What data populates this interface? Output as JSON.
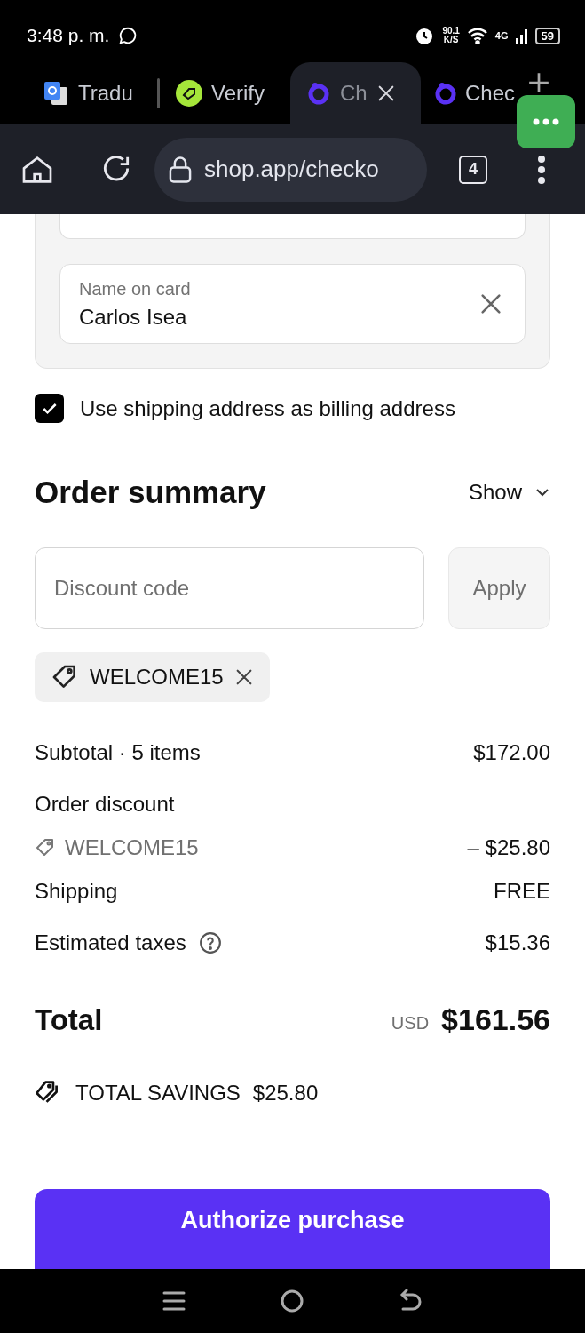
{
  "status_bar": {
    "time": "3:48 p. m.",
    "speed": "90.1",
    "speed_unit": "K/S",
    "network": "4G",
    "battery": "59"
  },
  "browser": {
    "tabs": [
      {
        "label": "Tradu",
        "kind": "translate",
        "selected": false
      },
      {
        "label": "Verify",
        "kind": "tag",
        "selected": false
      },
      {
        "label": "Ch",
        "kind": "ring",
        "selected": true
      },
      {
        "label": "Chec",
        "kind": "ring",
        "selected": false
      }
    ],
    "url": "shop.app/checko",
    "tab_count": "4"
  },
  "payment": {
    "name_field": {
      "label": "Name on card",
      "value": "Carlos Isea"
    }
  },
  "billing_checkbox": {
    "label": "Use shipping address as billing address",
    "checked": true
  },
  "order_summary": {
    "title": "Order summary",
    "toggle": "Show",
    "expanded": false,
    "discount": {
      "placeholder": "Discount code",
      "button": "Apply"
    },
    "applied_codes": [
      "WELCOME15"
    ],
    "lines": [
      {
        "kind": "plain",
        "label": "Subtotal · 5 items",
        "value": "$172.00"
      },
      {
        "kind": "discount",
        "label": "Order discount",
        "code": "WELCOME15",
        "value": "– $25.80"
      },
      {
        "kind": "plain",
        "label": "Shipping",
        "value": "FREE"
      },
      {
        "kind": "help",
        "label": "Estimated taxes",
        "value": "$15.36"
      }
    ],
    "total": {
      "label": "Total",
      "currency": "USD",
      "value": "$161.56"
    },
    "savings": {
      "label": "TOTAL SAVINGS",
      "value": "$25.80"
    },
    "button": "Authorize purchase"
  }
}
